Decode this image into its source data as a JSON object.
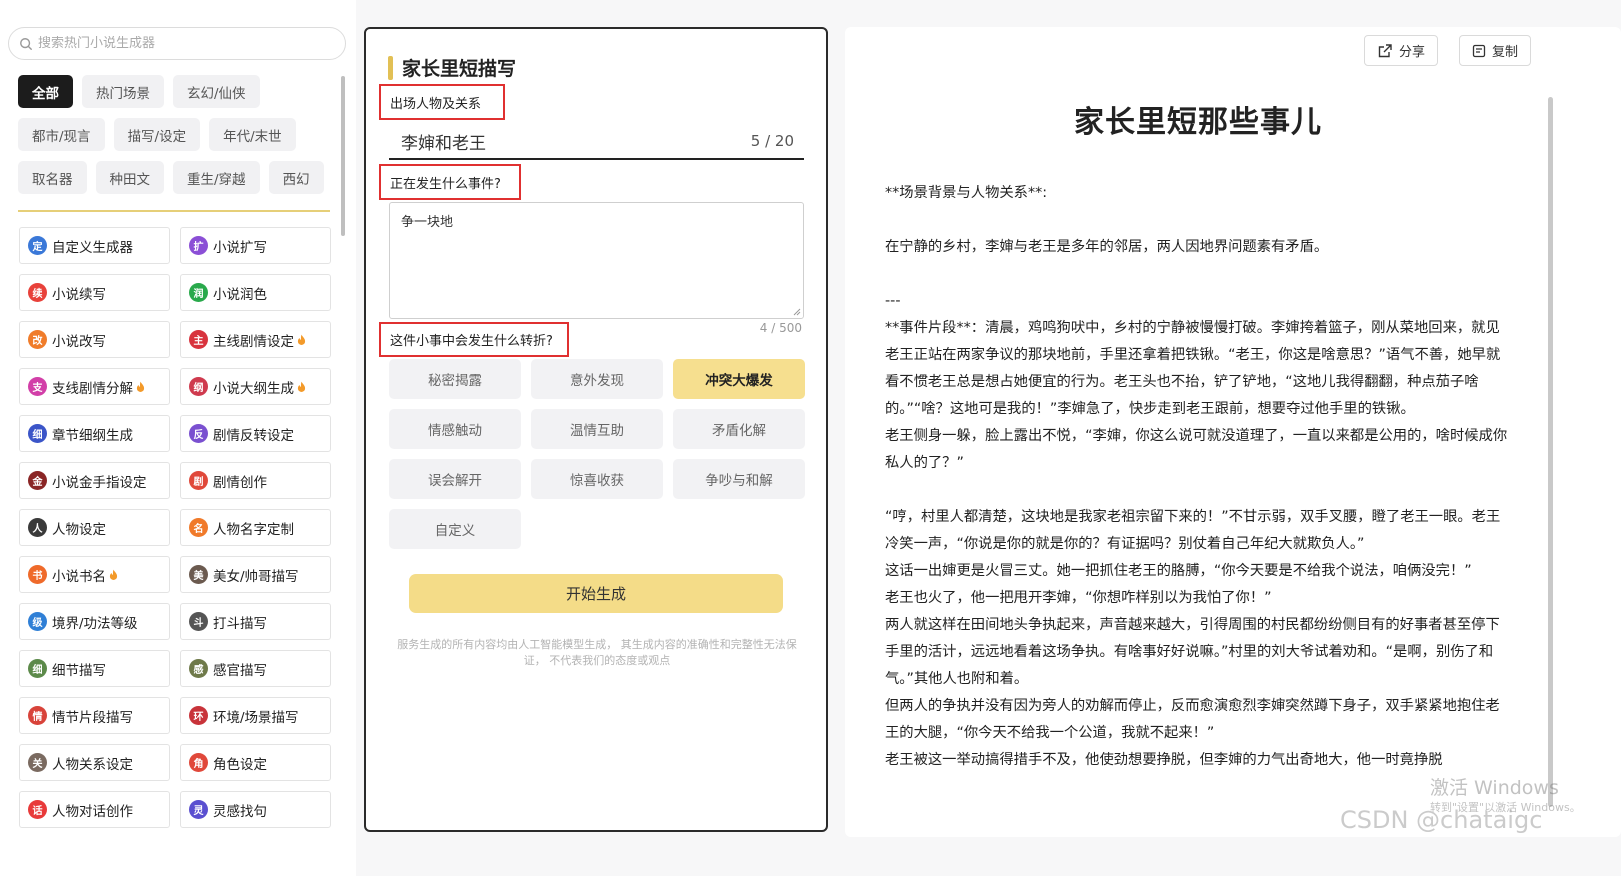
{
  "search": {
    "placeholder": "搜索热门小说生成器"
  },
  "categories": [
    {
      "label": "全部",
      "active": true
    },
    {
      "label": "热门场景"
    },
    {
      "label": "玄幻/仙侠"
    },
    {
      "label": "都市/现言"
    },
    {
      "label": "描写/设定"
    },
    {
      "label": "年代/末世"
    },
    {
      "label": "取名器"
    },
    {
      "label": "种田文"
    },
    {
      "label": "重生/穿越"
    },
    {
      "label": "西幻"
    }
  ],
  "tools": [
    {
      "label": "自定义生成器",
      "glyph": "定",
      "color": "#3a78d8",
      "hot": false
    },
    {
      "label": "小说扩写",
      "glyph": "扩",
      "color": "#8b4fd6",
      "hot": false
    },
    {
      "label": "小说续写",
      "glyph": "续",
      "color": "#e8413a",
      "hot": false
    },
    {
      "label": "小说润色",
      "glyph": "润",
      "color": "#29a94b",
      "hot": false
    },
    {
      "label": "小说改写",
      "glyph": "改",
      "color": "#f07c2a",
      "hot": false
    },
    {
      "label": "主线剧情设定",
      "glyph": "主",
      "color": "#d8333d",
      "hot": true
    },
    {
      "label": "支线剧情分解",
      "glyph": "支",
      "color": "#d23fa8",
      "hot": true
    },
    {
      "label": "小说大纲生成",
      "glyph": "纲",
      "color": "#cf3a4e",
      "hot": true
    },
    {
      "label": "章节细纲生成",
      "glyph": "细",
      "color": "#3b55c8",
      "hot": false
    },
    {
      "label": "剧情反转设定",
      "glyph": "反",
      "color": "#7a50d0",
      "hot": false
    },
    {
      "label": "小说金手指设定",
      "glyph": "金",
      "color": "#8a2525",
      "hot": false
    },
    {
      "label": "剧情创作",
      "glyph": "剧",
      "color": "#e0483a",
      "hot": false
    },
    {
      "label": "人物设定",
      "glyph": "人",
      "color": "#3a3a3a",
      "hot": false
    },
    {
      "label": "人物名字定制",
      "glyph": "名",
      "color": "#f07a2a",
      "hot": false
    },
    {
      "label": "小说书名",
      "glyph": "书",
      "color": "#ef6a2a",
      "hot": true
    },
    {
      "label": "美女/帅哥描写",
      "glyph": "美",
      "color": "#6b5a4f",
      "hot": false
    },
    {
      "label": "境界/功法等级",
      "glyph": "级",
      "color": "#2f7fd6",
      "hot": false
    },
    {
      "label": "打斗描写",
      "glyph": "斗",
      "color": "#555555",
      "hot": false
    },
    {
      "label": "细节描写",
      "glyph": "细",
      "color": "#5c8a4a",
      "hot": false
    },
    {
      "label": "感官描写",
      "glyph": "感",
      "color": "#6f7a4a",
      "hot": false
    },
    {
      "label": "情节片段描写",
      "glyph": "情",
      "color": "#d8433a",
      "hot": false
    },
    {
      "label": "环境/场景描写",
      "glyph": "环",
      "color": "#c8333a",
      "hot": false
    },
    {
      "label": "人物关系设定",
      "glyph": "关",
      "color": "#7a6a60",
      "hot": false
    },
    {
      "label": "角色设定",
      "glyph": "角",
      "color": "#e0483a",
      "hot": false
    },
    {
      "label": "人物对话创作",
      "glyph": "话",
      "color": "#e83a3a",
      "hot": false
    },
    {
      "label": "灵感找句",
      "glyph": "灵",
      "color": "#5a4fd0",
      "hot": false
    }
  ],
  "form": {
    "title": "家长里短描写",
    "field1_label": "出场人物及关系",
    "field1_value": "李婶和老王",
    "field1_count": "5 / 20",
    "field2_label": "正在发生什么事件?",
    "field2_value": "争一块地",
    "field2_count": "4 / 500",
    "field3_label": "这件小事中会发生什么转折?",
    "twists": [
      {
        "label": "秘密揭露"
      },
      {
        "label": "意外发现"
      },
      {
        "label": "冲突大爆发",
        "selected": true
      },
      {
        "label": "情感触动"
      },
      {
        "label": "温情互助"
      },
      {
        "label": "矛盾化解"
      },
      {
        "label": "误会解开"
      },
      {
        "label": "惊喜收获"
      },
      {
        "label": "争吵与和解"
      },
      {
        "label": "自定义"
      }
    ],
    "generate_label": "开始生成",
    "disclaimer": "服务生成的所有内容均由人工智能模型生成， 其生成内容的准确性和完整性无法保证， 不代表我们的态度或观点"
  },
  "result": {
    "share_label": "分享",
    "copy_label": "复制",
    "title": "家长里短那些事儿",
    "paragraphs": [
      "**场景背景与人物关系**:",
      "",
      "在宁静的乡村，李婶与老王是多年的邻居，两人因地界问题素有矛盾。",
      "",
      "---",
      "**事件片段**：清晨，鸡鸣狗吠中，乡村的宁静被慢慢打破。李婶挎着篮子，刚从菜地回来，就见老王正站在两家争议的那块地前，手里还拿着把铁锹。“老王，你这是啥意思？”语气不善，她早就看不惯老王总是想占她便宜的行为。老王头也不抬，铲了铲地，“这地儿我得翻翻，种点茄子啥的。”“啥？这地可是我的！”李婶急了，快步走到老王跟前，想要夺过他手里的铁锹。",
      "老王侧身一躲，脸上露出不悦，“李婶，你这么说可就没道理了，一直以来都是公用的，啥时候成你私人的了？”",
      "",
      "“哼，村里人都清楚，这块地是我家老祖宗留下来的！”不甘示弱，双手叉腰，瞪了老王一眼。老王冷笑一声，“你说是你的就是你的？有证据吗？别仗着自己年纪大就欺负人。”",
      "这话一出婶更是火冒三丈。她一把抓住老王的胳膊，“你今天要是不给我个说法，咱俩没完！”",
      "老王也火了，他一把甩开李婶，“你想咋样别以为我怕了你！”",
      "两人就这样在田间地头争执起来，声音越来越大，引得周围的村民都纷纷侧目有的好事者甚至停下手里的活计，远远地看着这场争执。有啥事好好说嘛。”村里的刘大爷试着劝和。“是啊，别伤了和气。”其他人也附和着。",
      "但两人的争执并没有因为旁人的劝解而停止，反而愈演愈烈李婶突然蹲下身子，双手紧紧地抱住老王的大腿，“你今天不给我一个公道，我就不起来！”",
      "老王被这一举动搞得措手不及，他使劲想要挣脱，但李婶的力气出奇地大，他一时竟挣脱"
    ]
  },
  "watermarks": {
    "windows_line1": "激活 Windows",
    "windows_line2": "转到\"设置\"以激活 Windows。",
    "csdn": "CSDN @chataigc"
  }
}
